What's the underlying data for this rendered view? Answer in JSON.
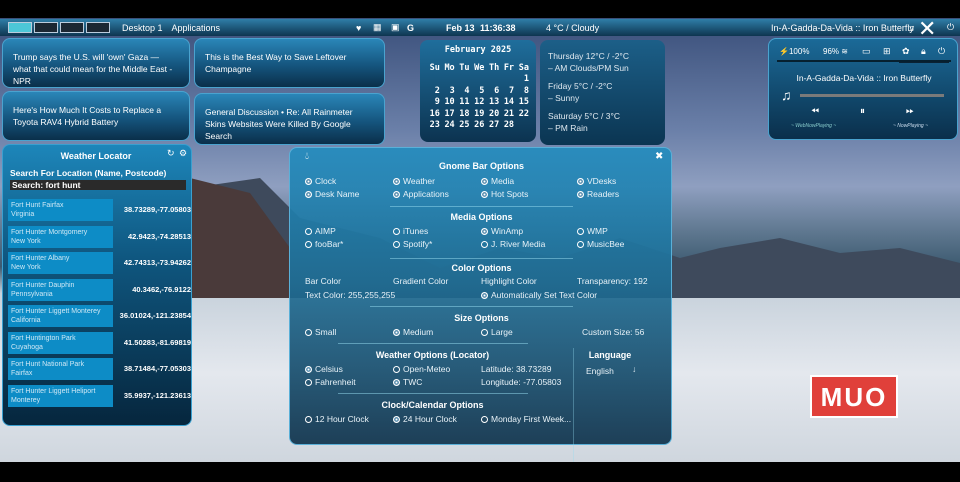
{
  "topbar": {
    "desktop": "Desktop 1",
    "applications": "Applications",
    "date": "Feb 13",
    "time": "11:36:38",
    "weather": "4 °C / Cloudy",
    "now_playing": "In-A-Gadda-Da-Vida :: Iron Butterfly"
  },
  "news": [
    "Trump says the U.S. will 'own' Gaza — what that could mean for the Middle East - NPR",
    "This is the Best Way to Save Leftover Champagne",
    "Here's How Much It Costs to Replace a Toyota RAV4 Hybrid Battery",
    "General Discussion • Re: All Rainmeter Skins Websites Were Killed By Google Search"
  ],
  "calendar": {
    "title": "February 2025",
    "days": [
      "Su",
      "Mo",
      "Tu",
      "We",
      "Th",
      "Fr",
      "Sa"
    ],
    "weeks": [
      [
        "",
        "",
        "",
        "",
        "",
        "",
        "1"
      ],
      [
        "2",
        "3",
        "4",
        "5",
        "6",
        "7",
        "8"
      ],
      [
        "9",
        "10",
        "11",
        "12",
        "13",
        "14",
        "15"
      ],
      [
        "16",
        "17",
        "18",
        "19",
        "20",
        "21",
        "22"
      ],
      [
        "23",
        "24",
        "25",
        "26",
        "27",
        "28",
        ""
      ]
    ]
  },
  "forecast": [
    {
      "day": "Thursday 12°C / -2°C",
      "desc": "– AM Clouds/PM Sun"
    },
    {
      "day": "Friday 5°C / -2°C",
      "desc": "– Sunny"
    },
    {
      "day": "Saturday 5°C / 3°C",
      "desc": "– PM Rain"
    }
  ],
  "media": {
    "battery": "100%",
    "wifi": "96%",
    "track": "In-A-Gadda-Da-Vida :: Iron Butterfly",
    "left_label": "~ WebNowPlaying ~",
    "right_label": "~ NowPlaying ~",
    "progress": 0
  },
  "locator": {
    "title": "Weather Locator",
    "prompt": "Search For Location (Name, Postcode)",
    "search": "Search: fort hunt",
    "results": [
      {
        "name": "Fort Hunt Fairfax",
        "region": "Virginia",
        "coords": "38.73289,-77.05803"
      },
      {
        "name": "Fort Hunter Montgomery",
        "region": "New York",
        "coords": "42.9423,-74.28513"
      },
      {
        "name": "Fort Hunter Albany",
        "region": "New York",
        "coords": "42.74313,-73.94262"
      },
      {
        "name": "Fort Hunter Dauphin",
        "region": "Pennsylvania",
        "coords": "40.3462,-76.9122"
      },
      {
        "name": "Fort Hunter Liggett Monterey",
        "region": "California",
        "coords": "36.01024,-121.23854"
      },
      {
        "name": "Fort Huntington Park",
        "region": "Cuyahoga",
        "coords": "41.50283,-81.69819"
      },
      {
        "name": "Fort Hunt National Park",
        "region": "Fairfax",
        "coords": "38.71484,-77.05303"
      },
      {
        "name": "Fort Hunter Liggett Heliport",
        "region": "Monterey",
        "coords": "35.9937,-121.23613"
      }
    ]
  },
  "options": {
    "gnome_title": "Gnome Bar Options",
    "gnome": [
      "Clock",
      "Weather",
      "Media",
      "VDesks",
      "Desk Name",
      "Applications",
      "Hot Spots",
      "Readers"
    ],
    "media_title": "Media Options",
    "media": [
      "AIMP",
      "iTunes",
      "WinAmp",
      "WMP",
      "fooBar*",
      "Spotify*",
      "J. River Media",
      "MusicBee"
    ],
    "color_title": "Color Options",
    "bar_color": "Bar Color",
    "gradient_color": "Gradient Color",
    "highlight_color": "Highlight Color",
    "transparency": "Transparency: 192",
    "text_color": "Text Color: 255,255,255",
    "auto_text": "Automatically Set Text Color",
    "size_title": "Size Options",
    "small": "Small",
    "medium": "Medium",
    "large": "Large",
    "custom_size": "Custom Size: 56",
    "weather_title": "Weather Options (Locator)",
    "celsius": "Celsius",
    "open_meteo": "Open-Meteo",
    "latitude": "Latitude: 38.73289",
    "fahrenheit": "Fahrenheit",
    "twc": "TWC",
    "longitude": "Longitude: -77.05803",
    "language_title": "Language",
    "language": "English",
    "clock_title": "Clock/Calendar Options",
    "h12": "12 Hour Clock",
    "h24": "24 Hour Clock",
    "monday": "Monday First Week..."
  },
  "logo": "MUO"
}
